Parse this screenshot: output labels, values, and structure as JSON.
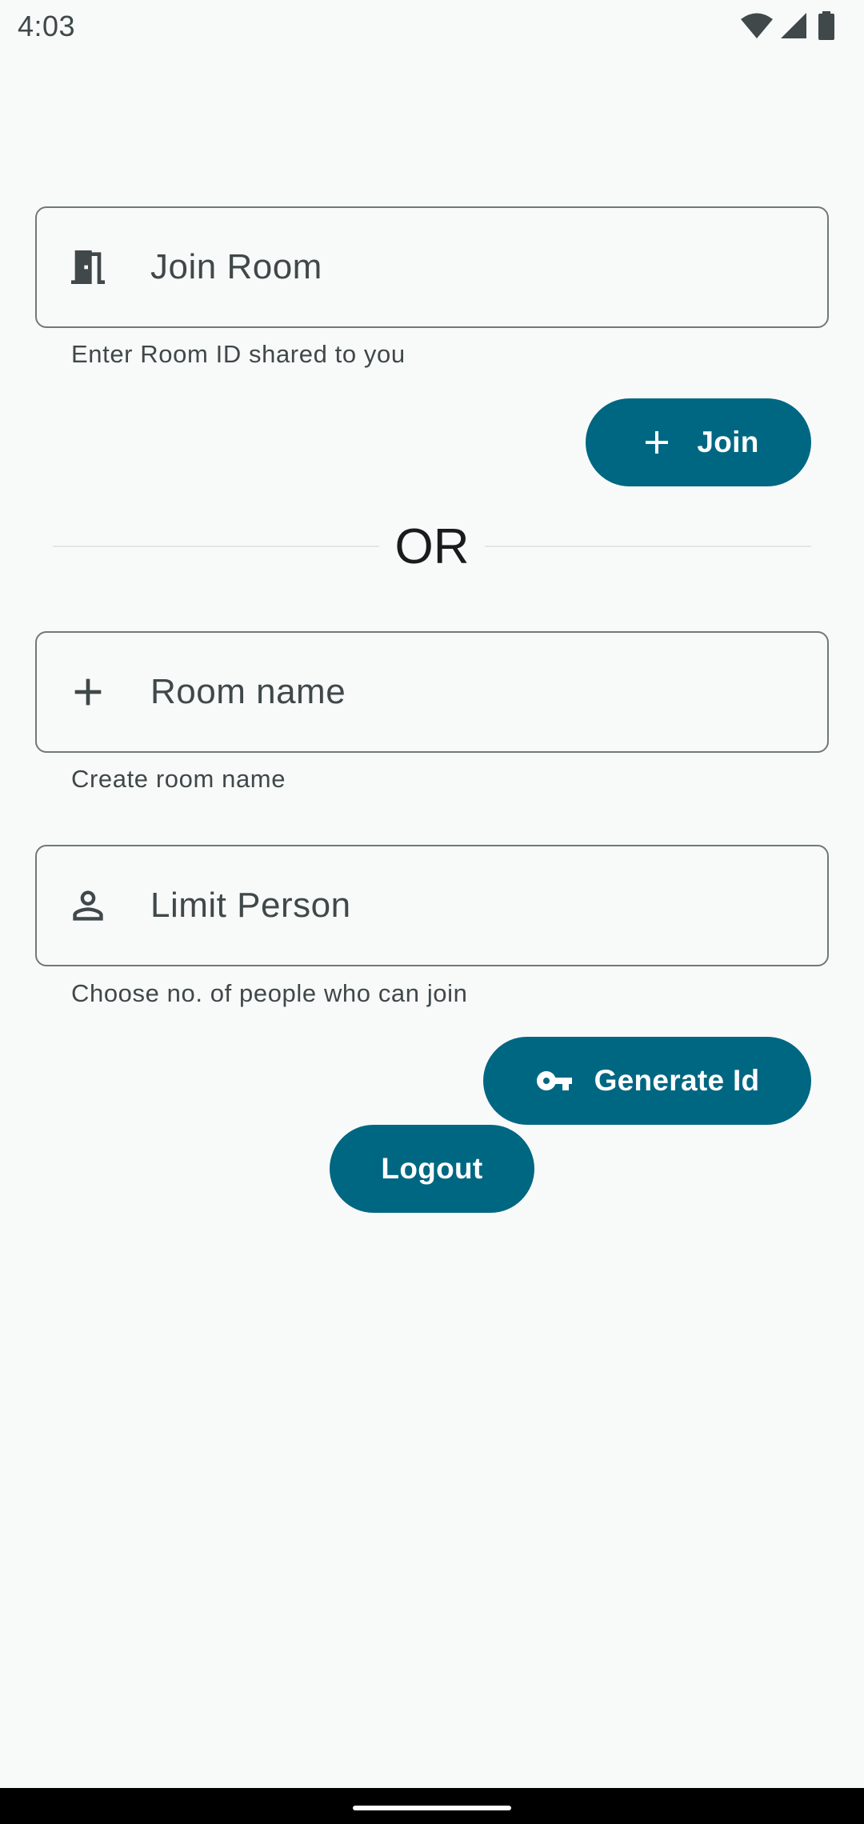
{
  "status_bar": {
    "time": "4:03",
    "icons": [
      "wifi-icon",
      "cellular-signal-icon",
      "battery-icon"
    ]
  },
  "join_room": {
    "field_label": "Join Room",
    "field_icon": "door-icon",
    "supporting_text": "Enter Room ID shared to you",
    "button_label": "Join",
    "button_icon": "plus-icon"
  },
  "divider": {
    "text": "OR"
  },
  "create_room": {
    "room_name_label": "Room name",
    "room_name_icon": "plus-icon",
    "room_name_supporting": "Create room name",
    "limit_label": "Limit Person",
    "limit_icon": "person-icon",
    "limit_supporting": "Choose no. of people who can join",
    "generate_label": "Generate Id",
    "generate_icon": "key-icon"
  },
  "logout": {
    "label": "Logout"
  },
  "colors": {
    "background": "#f8fafa",
    "primary": "#006782",
    "on_primary": "#ffffff",
    "outline": "#6f7979",
    "on_surface_variant": "#404849",
    "nav_bar": "#000000"
  }
}
